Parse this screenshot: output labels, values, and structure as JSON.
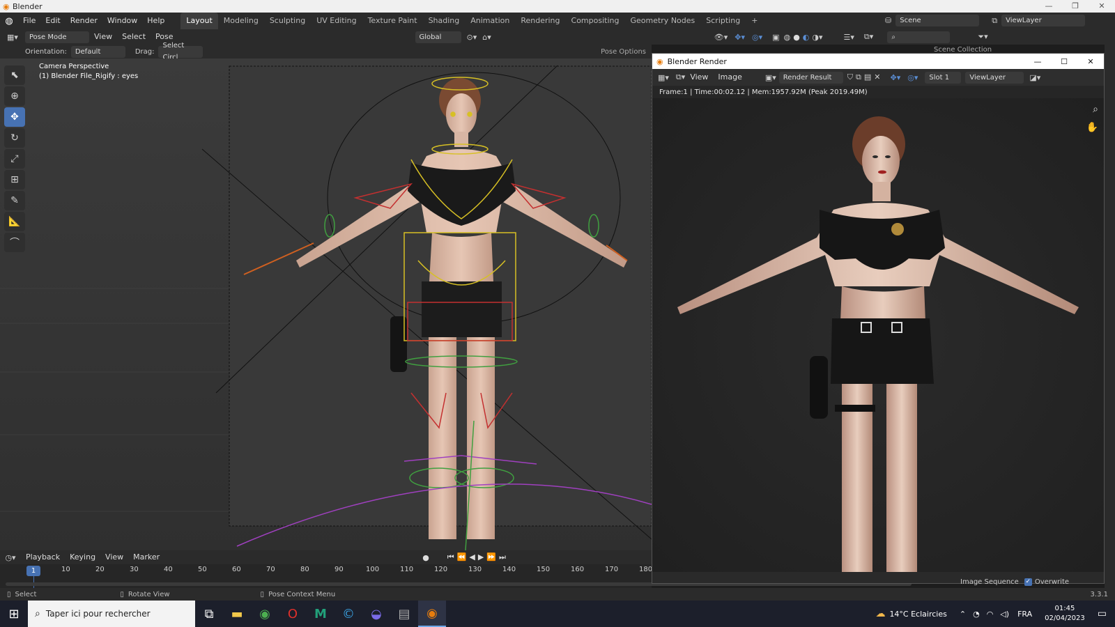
{
  "window": {
    "title": "Blender",
    "controls": [
      "—",
      "❐",
      "✕"
    ]
  },
  "topbar": {
    "menu": [
      "File",
      "Edit",
      "Render",
      "Window",
      "Help"
    ],
    "workspaces": [
      "Layout",
      "Modeling",
      "Sculpting",
      "UV Editing",
      "Texture Paint",
      "Shading",
      "Animation",
      "Rendering",
      "Compositing",
      "Geometry Nodes",
      "Scripting"
    ],
    "active_workspace": "Layout",
    "add_tab": "+",
    "scene": "Scene",
    "view_layer": "ViewLayer"
  },
  "header": {
    "mode": "Pose Mode",
    "menu": [
      "View",
      "Select",
      "Pose"
    ],
    "transform_orientation": "Global",
    "pose_options": "Pose Options"
  },
  "tool_settings": {
    "orientation_label": "Orientation:",
    "orientation_value": "Default",
    "drag_label": "Drag:",
    "drag_value": "Select Circl"
  },
  "viewport": {
    "line1": "Camera Perspective",
    "line2": "(1) Blender File_Rigify : eyes"
  },
  "tools": [
    "cursor-select",
    "cursor-3d",
    "move",
    "rotate",
    "scale",
    "transform",
    "annotate",
    "measure",
    "bone-roll"
  ],
  "outliner": {
    "label": "Scene Collection"
  },
  "render_window": {
    "title": "Blender Render",
    "menu": [
      "View",
      "Image"
    ],
    "image_name": "Render Result",
    "slot": "Slot 1",
    "view_layer": "ViewLayer",
    "info": "Frame:1 | Time:00:02.12 | Mem:1957.92M (Peak 2019.49M)",
    "image_sequence_label": "Image Sequence",
    "overwrite_label": "Overwrite",
    "overwrite_checked": true
  },
  "timeline": {
    "menu": [
      "Playback",
      "Keying",
      "View",
      "Marker"
    ],
    "current_frame": "1",
    "ticks": [
      "10",
      "20",
      "30",
      "40",
      "50",
      "60",
      "70",
      "80",
      "90",
      "100",
      "110",
      "120",
      "130",
      "140",
      "150",
      "160",
      "170",
      "180"
    ]
  },
  "statusbar": {
    "select": "Select",
    "rotate": "Rotate View",
    "context": "Pose Context Menu",
    "version": "3.3.1"
  },
  "taskbar": {
    "search_placeholder": "Taper ici pour rechercher",
    "weather": "14°C Eclaircies",
    "language": "FRA",
    "time": "01:45",
    "date": "02/04/2023"
  },
  "colors": {
    "accent": "#4772b3",
    "bg": "#1d1d1d",
    "panel": "#2b2b2b"
  }
}
